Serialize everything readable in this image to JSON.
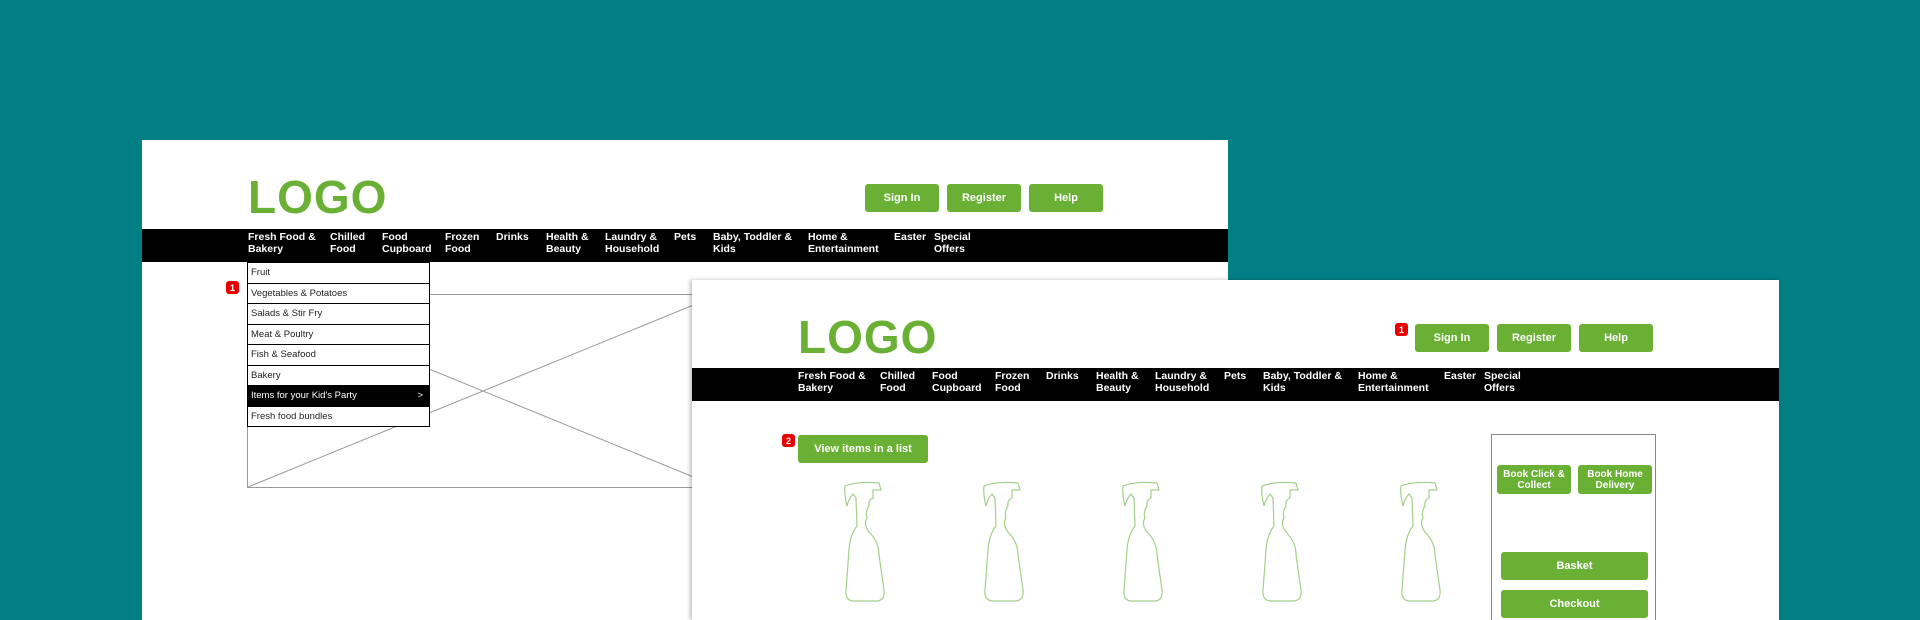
{
  "logo_text": "LOGO",
  "header_buttons": {
    "sign_in": "Sign In",
    "register": "Register",
    "help": "Help"
  },
  "nav": [
    {
      "l1": "Fresh Food &",
      "l2": "Bakery"
    },
    {
      "l1": "Chilled",
      "l2": "Food"
    },
    {
      "l1": "Food",
      "l2": "Cupboard"
    },
    {
      "l1": "Frozen",
      "l2": "Food"
    },
    {
      "l1": "Drinks",
      "l2": ""
    },
    {
      "l1": "Health &",
      "l2": "Beauty"
    },
    {
      "l1": "Laundry &",
      "l2": "Household"
    },
    {
      "l1": "Pets",
      "l2": ""
    },
    {
      "l1": "Baby, Toddler &",
      "l2": "Kids"
    },
    {
      "l1": "Home &",
      "l2": "Entertainment"
    },
    {
      "l1": "Easter",
      "l2": ""
    },
    {
      "l1": "Special",
      "l2": "Offers"
    }
  ],
  "dropdown_items": [
    "Fruit",
    "Vegetables & Potatoes",
    "Salads & Stir Fry",
    "Meat & Poultry",
    "Fish & Seafood",
    "Bakery",
    "Items for your Kid's Party",
    "Fresh food bundles"
  ],
  "dropdown_caret": ">",
  "badges": {
    "back_dropdown": "1",
    "front_signin": "1",
    "front_view_list": "2"
  },
  "view_list_button": "View items in a list",
  "sidebar": {
    "book_click_collect": "Book Click & Collect",
    "book_home_delivery": "Book Home Delivery",
    "basket": "Basket",
    "checkout": "Checkout"
  },
  "colors": {
    "background": "#017f84",
    "accent_green": "#6ab035",
    "nav_black": "#000000",
    "badge_red": "#e60000",
    "bottle_outline": "#a3cf8a"
  },
  "icons": {
    "product_placeholder": "spray-bottle-icon",
    "image_placeholder": "crossed-box-icon"
  }
}
